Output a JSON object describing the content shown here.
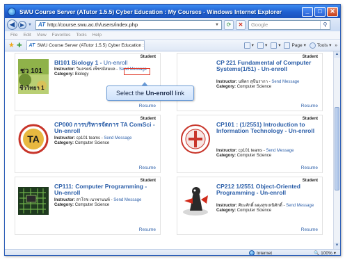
{
  "window": {
    "title": "SWU Course Server (ATutor 1.5.5) Cyber Education : My Courses - Windows Internet Explorer",
    "controls": {
      "minimize": "_",
      "maximize": "□",
      "close": "✕"
    }
  },
  "address_bar": {
    "url": "http://course.swu.ac.th/users/index.php",
    "search_placeholder": "Google"
  },
  "menu": [
    "File",
    "Edit",
    "View",
    "Favorites",
    "Tools",
    "Help"
  ],
  "tab": {
    "label": "SWU Course Server (ATutor 1.5.5) Cyber Education :..."
  },
  "command_bar": {
    "page_label": "Page",
    "tools_label": "Tools"
  },
  "courses": [
    {
      "role": "Student",
      "title": "BI101 Biology 1",
      "unenroll": "Un-enroll",
      "instructor_label": "Instructor:",
      "instructor": "วิมลรตน์ เพ็ชรมีสมยล",
      "send_message": "Send Message",
      "category_label": "Category:",
      "category": "Biology",
      "resume": "Resume"
    },
    {
      "role": "Student",
      "title": "CP 221 Fundamental of Computer Systems(1/51)",
      "unenroll": "Un-enroll",
      "instructor_label": "Instructor:",
      "instructor": "นพิตร สุขีนรากา",
      "send_message": "Send Message",
      "category_label": "Category:",
      "category": "Computer Science",
      "resume": "Resume"
    },
    {
      "role": "Student",
      "title": "CP000 การบริหารจัดการ TA ComSci",
      "unenroll": "Un-enroll",
      "instructor_label": "Instructor:",
      "instructor": "cp101 teams",
      "send_message": "Send Message",
      "category_label": "Category:",
      "category": "Computer Science",
      "resume": "Resume"
    },
    {
      "role": "Student",
      "title": "CP101 : (1/2551) Introduction to Information Technology",
      "unenroll": "Un-enroll",
      "instructor_label": "Instructor:",
      "instructor": "cp101 teams",
      "send_message": "Send Message",
      "category_label": "Category:",
      "category": "Computer Science",
      "resume": "Resume"
    },
    {
      "role": "Student",
      "title": "CP111: Computer Programming",
      "unenroll": "Un-enroll",
      "instructor_label": "Instructor:",
      "instructor": "สาโรช เนาพานนท์",
      "send_message": "Send Message",
      "category_label": "Category:",
      "category": "Computer Science",
      "resume": "Resume"
    },
    {
      "role": "Student",
      "title": "CP212 1/2551 Object-Oriented Programming",
      "unenroll": "Un-enroll",
      "instructor_label": "Instructor:",
      "instructor": "ศิยะศักดิ์ ผดุงสุขเหนิศักดิ์",
      "send_message": "Send Message",
      "category_label": "Category:",
      "category": "Computer Science",
      "resume": "Resume"
    }
  ],
  "thumbnail_text": {
    "biology_code": "ชว 101",
    "biology_word": "ชีววิทยา 1",
    "ta_logo": "TA"
  },
  "callout": {
    "prefix": "Select the",
    "emphasis": "Un-enroll",
    "suffix": "link"
  },
  "status_bar": {
    "zone": "Internet",
    "zoom": "100%"
  },
  "colors": {
    "link": "#2b5ea8",
    "title": "#3e6aa6",
    "highlight": "#e03a2a",
    "titlebar": "#1f5fd0"
  }
}
